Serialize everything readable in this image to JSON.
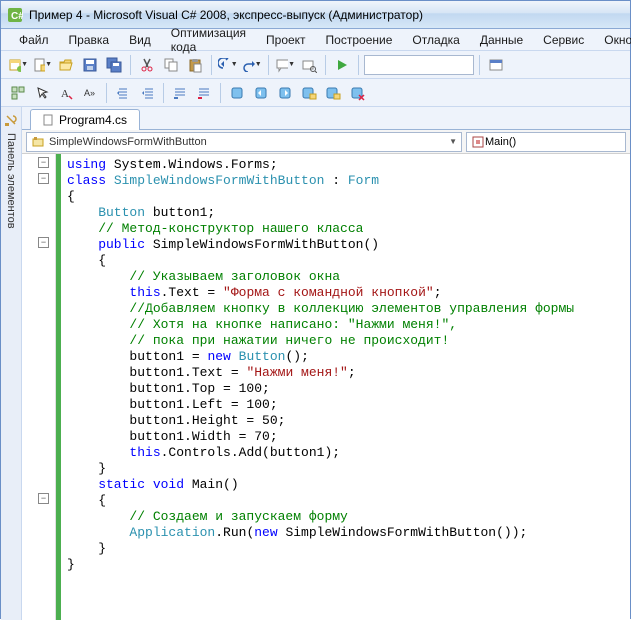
{
  "title": "Пример 4 - Microsoft Visual C# 2008, экспресс-выпуск (Администратор)",
  "menu": {
    "file": "Файл",
    "edit": "Правка",
    "view": "Вид",
    "optimize": "Оптимизация кода",
    "project": "Проект",
    "build": "Построение",
    "debug": "Отладка",
    "data": "Данные",
    "service": "Сервис",
    "window": "Окно"
  },
  "sidepanel_label": "Панель элементов",
  "tab_label": "Program4.cs",
  "nav_class": "SimpleWindowsFormWithButton",
  "nav_member": "Main()",
  "code": {
    "l1_kw": "using",
    "l1_rest": " System.Windows.Forms;",
    "l2_kw": "class",
    "l2_type": " SimpleWindowsFormWithButton",
    "l2_rest": " : ",
    "l2_type2": "Form",
    "l3": "{",
    "l4_type": "    Button",
    "l4_rest": " button1;",
    "l5_cmt": "    // Метод-конструктор нашего класса",
    "l6_kw": "    public",
    "l6_rest": " SimpleWindowsFormWithButton()",
    "l7": "    {",
    "l8_cmt": "        // Указываем заголовок окна",
    "l9_kw": "        this",
    "l9_rest": ".Text = ",
    "l9_str": "\"Форма с командной кнопкой\"",
    "l9_end": ";",
    "l10_cmt": "        //Добавляем кнопку в коллекцию элементов управления формы",
    "l11_cmt": "        // Хотя на кнопке написано: \"Нажми меня!\",",
    "l12_cmt": "        // пока при нажатии ничего не происходит!",
    "l13a": "        button1 = ",
    "l13_kw": "new",
    "l13b": " ",
    "l13_type": "Button",
    "l13c": "();",
    "l14a": "        button1.Text = ",
    "l14_str": "\"Нажми меня!\"",
    "l14b": ";",
    "l15": "        button1.Top = 100;",
    "l16": "        button1.Left = 100;",
    "l17": "        button1.Height = 50;",
    "l18": "        button1.Width = 70;",
    "l19_kw": "        this",
    "l19_rest": ".Controls.Add(button1);",
    "l20": "    }",
    "l21_kw1": "    static",
    "l21_kw2": " void",
    "l21_rest": " Main()",
    "l22": "    {",
    "l23_cmt": "        // Создаем и запускаем форму",
    "l24_type": "        Application",
    "l24a": ".Run(",
    "l24_kw": "new",
    "l24b": " SimpleWindowsFormWithButton());",
    "l25": "    }",
    "l26": "}"
  }
}
